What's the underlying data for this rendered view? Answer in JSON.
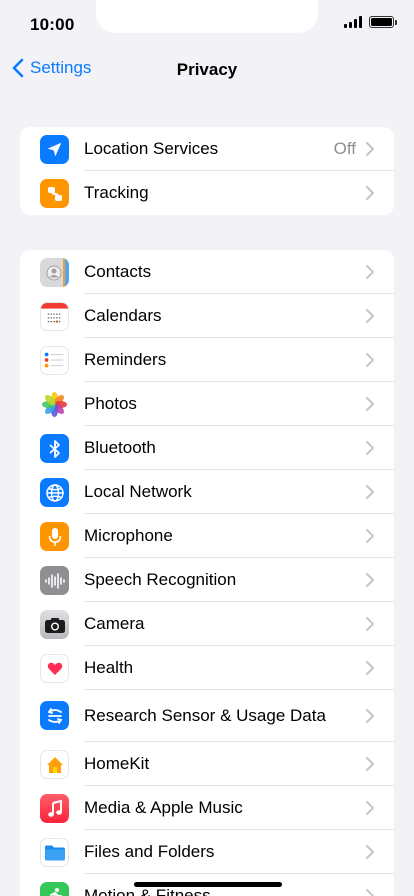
{
  "status_bar": {
    "time": "10:00"
  },
  "nav": {
    "back_label": "Settings",
    "title": "Privacy"
  },
  "group1": [
    {
      "label": "Location Services",
      "value": "Off",
      "icon": "location-arrow-icon"
    },
    {
      "label": "Tracking",
      "value": "",
      "icon": "tracking-icon"
    }
  ],
  "group2": [
    {
      "label": "Contacts",
      "icon": "contacts-icon"
    },
    {
      "label": "Calendars",
      "icon": "calendar-icon"
    },
    {
      "label": "Reminders",
      "icon": "reminders-icon"
    },
    {
      "label": "Photos",
      "icon": "photos-icon"
    },
    {
      "label": "Bluetooth",
      "icon": "bluetooth-icon"
    },
    {
      "label": "Local Network",
      "icon": "globe-icon"
    },
    {
      "label": "Microphone",
      "icon": "microphone-icon"
    },
    {
      "label": "Speech Recognition",
      "icon": "waveform-icon"
    },
    {
      "label": "Camera",
      "icon": "camera-icon"
    },
    {
      "label": "Health",
      "icon": "heart-icon"
    },
    {
      "label": "Research Sensor & Usage Data",
      "icon": "research-icon"
    },
    {
      "label": "HomeKit",
      "icon": "home-icon"
    },
    {
      "label": "Media & Apple Music",
      "icon": "music-note-icon"
    },
    {
      "label": "Files and Folders",
      "icon": "folder-icon"
    },
    {
      "label": "Motion & Fitness",
      "icon": "fitness-icon"
    }
  ],
  "colors": {
    "accent": "#0a7aff",
    "background": "#f2f2f7",
    "secondary_text": "#8e8e93"
  }
}
